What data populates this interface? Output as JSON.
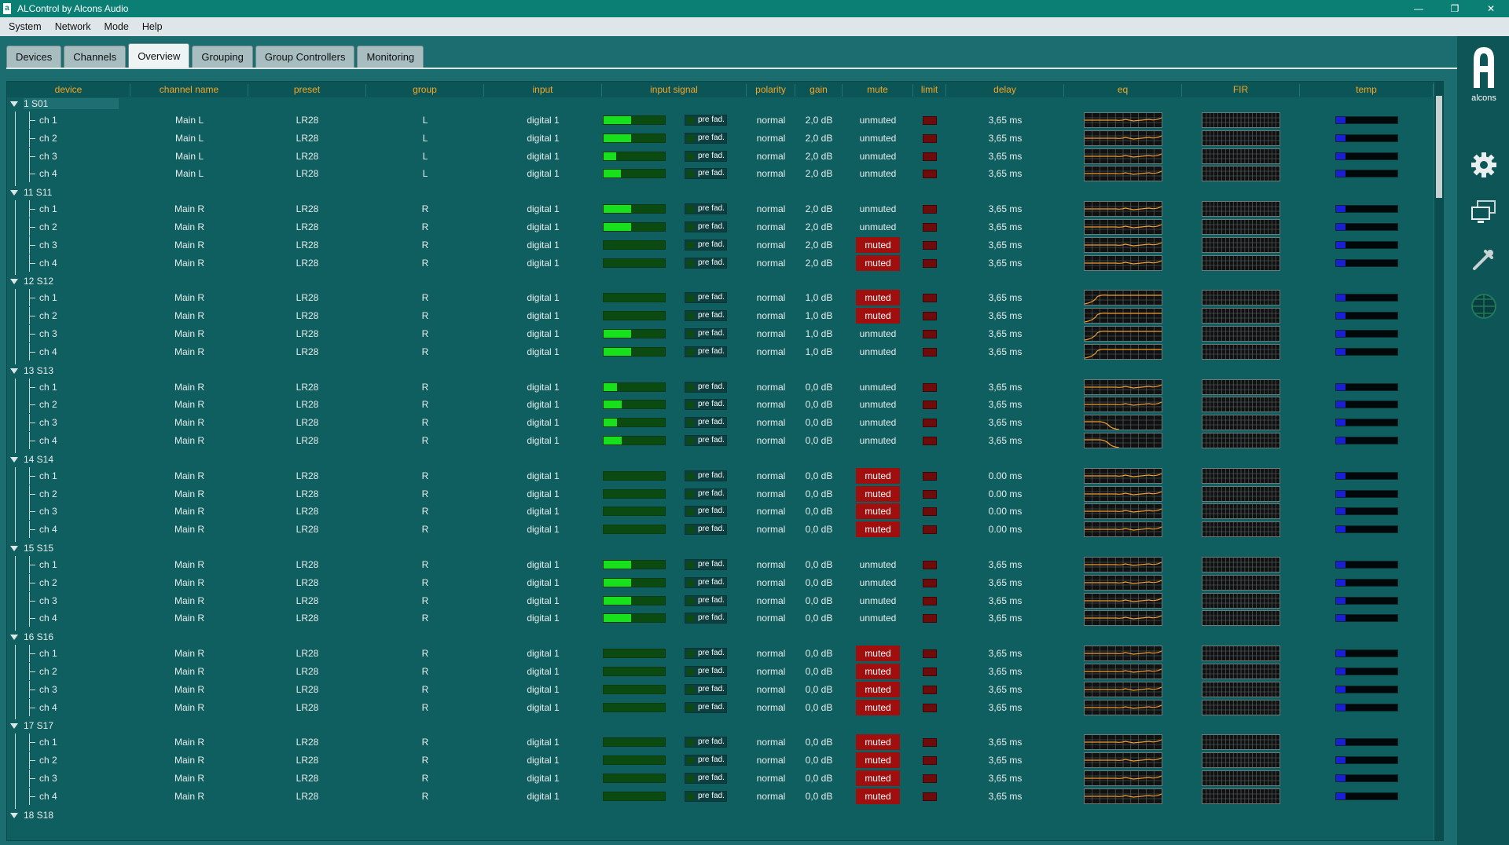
{
  "window": {
    "title": "ALControl by Alcons Audio",
    "min": "—",
    "restore": "❐",
    "close": "✕"
  },
  "menu": [
    "System",
    "Network",
    "Mode",
    "Help"
  ],
  "tabs": [
    {
      "label": "Devices",
      "active": false
    },
    {
      "label": "Channels",
      "active": false
    },
    {
      "label": "Overview",
      "active": true
    },
    {
      "label": "Grouping",
      "active": false
    },
    {
      "label": "Group Controllers",
      "active": false
    },
    {
      "label": "Monitoring",
      "active": false
    }
  ],
  "sidebar": {
    "logo": "alcons",
    "icons": [
      "settings-gear-icon",
      "network-computers-icon",
      "tools-icon",
      "globe-map-icon"
    ]
  },
  "columns": [
    "device",
    "channel name",
    "preset",
    "group",
    "input",
    "input signal",
    "polarity",
    "gain",
    "mute",
    "limit",
    "delay",
    "eq",
    "FIR",
    "temp"
  ],
  "pref_label": "pre fad.",
  "devices": [
    {
      "label": "1 S01",
      "selected": true,
      "channels": [
        {
          "ch": "ch 1",
          "name": "Main L",
          "preset": "LR28",
          "group": "L",
          "input": "digital 1",
          "signal": 0.45,
          "polarity": "normal",
          "gain": "2,0 dB",
          "mute": "unmuted",
          "delay": "3,65 ms",
          "eq": "flat",
          "temp": 0.15
        },
        {
          "ch": "ch 2",
          "name": "Main L",
          "preset": "LR28",
          "group": "L",
          "input": "digital 1",
          "signal": 0.45,
          "polarity": "normal",
          "gain": "2,0 dB",
          "mute": "unmuted",
          "delay": "3,65 ms",
          "eq": "flat",
          "temp": 0.15
        },
        {
          "ch": "ch 3",
          "name": "Main L",
          "preset": "LR28",
          "group": "L",
          "input": "digital 1",
          "signal": 0.2,
          "polarity": "normal",
          "gain": "2,0 dB",
          "mute": "unmuted",
          "delay": "3,65 ms",
          "eq": "flat",
          "temp": 0.15
        },
        {
          "ch": "ch 4",
          "name": "Main L",
          "preset": "LR28",
          "group": "L",
          "input": "digital 1",
          "signal": 0.28,
          "polarity": "normal",
          "gain": "2,0 dB",
          "mute": "unmuted",
          "delay": "3,65 ms",
          "eq": "flat",
          "temp": 0.15
        }
      ]
    },
    {
      "label": "11 S11",
      "selected": false,
      "channels": [
        {
          "ch": "ch 1",
          "name": "Main R",
          "preset": "LR28",
          "group": "R",
          "input": "digital 1",
          "signal": 0.45,
          "polarity": "normal",
          "gain": "2,0 dB",
          "mute": "unmuted",
          "delay": "3,65 ms",
          "eq": "flat",
          "temp": 0.15
        },
        {
          "ch": "ch 2",
          "name": "Main R",
          "preset": "LR28",
          "group": "R",
          "input": "digital 1",
          "signal": 0.45,
          "polarity": "normal",
          "gain": "2,0 dB",
          "mute": "unmuted",
          "delay": "3,65 ms",
          "eq": "flat",
          "temp": 0.15
        },
        {
          "ch": "ch 3",
          "name": "Main R",
          "preset": "LR28",
          "group": "R",
          "input": "digital 1",
          "signal": 0,
          "polarity": "normal",
          "gain": "2,0 dB",
          "mute": "muted",
          "delay": "3,65 ms",
          "eq": "flat",
          "temp": 0.15
        },
        {
          "ch": "ch 4",
          "name": "Main R",
          "preset": "LR28",
          "group": "R",
          "input": "digital 1",
          "signal": 0,
          "polarity": "normal",
          "gain": "2,0 dB",
          "mute": "muted",
          "delay": "3,65 ms",
          "eq": "flat",
          "temp": 0.15
        }
      ]
    },
    {
      "label": "12 S12",
      "selected": false,
      "channels": [
        {
          "ch": "ch 1",
          "name": "Main R",
          "preset": "LR28",
          "group": "R",
          "input": "digital 1",
          "signal": 0,
          "polarity": "normal",
          "gain": "1,0 dB",
          "mute": "muted",
          "delay": "3,65 ms",
          "eq": "highpass",
          "temp": 0.15
        },
        {
          "ch": "ch 2",
          "name": "Main R",
          "preset": "LR28",
          "group": "R",
          "input": "digital 1",
          "signal": 0,
          "polarity": "normal",
          "gain": "1,0 dB",
          "mute": "muted",
          "delay": "3,65 ms",
          "eq": "highpass",
          "temp": 0.15
        },
        {
          "ch": "ch 3",
          "name": "Main R",
          "preset": "LR28",
          "group": "R",
          "input": "digital 1",
          "signal": 0.45,
          "polarity": "normal",
          "gain": "1,0 dB",
          "mute": "unmuted",
          "delay": "3,65 ms",
          "eq": "highpass",
          "temp": 0.15
        },
        {
          "ch": "ch 4",
          "name": "Main R",
          "preset": "LR28",
          "group": "R",
          "input": "digital 1",
          "signal": 0.45,
          "polarity": "normal",
          "gain": "1,0 dB",
          "mute": "unmuted",
          "delay": "3,65 ms",
          "eq": "highpass",
          "temp": 0.15
        }
      ]
    },
    {
      "label": "13 S13",
      "selected": false,
      "channels": [
        {
          "ch": "ch 1",
          "name": "Main R",
          "preset": "LR28",
          "group": "R",
          "input": "digital 1",
          "signal": 0.22,
          "polarity": "normal",
          "gain": "0,0 dB",
          "mute": "unmuted",
          "delay": "3,65 ms",
          "eq": "flat",
          "temp": 0.15
        },
        {
          "ch": "ch 2",
          "name": "Main R",
          "preset": "LR28",
          "group": "R",
          "input": "digital 1",
          "signal": 0.3,
          "polarity": "normal",
          "gain": "0,0 dB",
          "mute": "unmuted",
          "delay": "3,65 ms",
          "eq": "flat",
          "temp": 0.15
        },
        {
          "ch": "ch 3",
          "name": "Main R",
          "preset": "LR28",
          "group": "R",
          "input": "digital 1",
          "signal": 0.22,
          "polarity": "normal",
          "gain": "0,0 dB",
          "mute": "unmuted",
          "delay": "3,65 ms",
          "eq": "lowpass",
          "temp": 0.15
        },
        {
          "ch": "ch 4",
          "name": "Main R",
          "preset": "LR28",
          "group": "R",
          "input": "digital 1",
          "signal": 0.3,
          "polarity": "normal",
          "gain": "0,0 dB",
          "mute": "unmuted",
          "delay": "3,65 ms",
          "eq": "lowpass",
          "temp": 0.15
        }
      ]
    },
    {
      "label": "14 S14",
      "selected": false,
      "channels": [
        {
          "ch": "ch 1",
          "name": "Main R",
          "preset": "LR28",
          "group": "R",
          "input": "digital 1",
          "signal": 0,
          "polarity": "normal",
          "gain": "0,0 dB",
          "mute": "muted",
          "delay": "0.00 ms",
          "eq": "flat",
          "temp": 0.15
        },
        {
          "ch": "ch 2",
          "name": "Main R",
          "preset": "LR28",
          "group": "R",
          "input": "digital 1",
          "signal": 0,
          "polarity": "normal",
          "gain": "0,0 dB",
          "mute": "muted",
          "delay": "0.00 ms",
          "eq": "flat",
          "temp": 0.15
        },
        {
          "ch": "ch 3",
          "name": "Main R",
          "preset": "LR28",
          "group": "R",
          "input": "digital 1",
          "signal": 0,
          "polarity": "normal",
          "gain": "0,0 dB",
          "mute": "muted",
          "delay": "0.00 ms",
          "eq": "flat",
          "temp": 0.15
        },
        {
          "ch": "ch 4",
          "name": "Main R",
          "preset": "LR28",
          "group": "R",
          "input": "digital 1",
          "signal": 0,
          "polarity": "normal",
          "gain": "0,0 dB",
          "mute": "muted",
          "delay": "0.00 ms",
          "eq": "flat",
          "temp": 0.15
        }
      ]
    },
    {
      "label": "15 S15",
      "selected": false,
      "channels": [
        {
          "ch": "ch 1",
          "name": "Main R",
          "preset": "LR28",
          "group": "R",
          "input": "digital 1",
          "signal": 0.45,
          "polarity": "normal",
          "gain": "0,0 dB",
          "mute": "unmuted",
          "delay": "3,65 ms",
          "eq": "flat",
          "temp": 0.15
        },
        {
          "ch": "ch 2",
          "name": "Main R",
          "preset": "LR28",
          "group": "R",
          "input": "digital 1",
          "signal": 0.45,
          "polarity": "normal",
          "gain": "0,0 dB",
          "mute": "unmuted",
          "delay": "3,65 ms",
          "eq": "flat",
          "temp": 0.15
        },
        {
          "ch": "ch 3",
          "name": "Main R",
          "preset": "LR28",
          "group": "R",
          "input": "digital 1",
          "signal": 0.45,
          "polarity": "normal",
          "gain": "0,0 dB",
          "mute": "unmuted",
          "delay": "3,65 ms",
          "eq": "flat",
          "temp": 0.15
        },
        {
          "ch": "ch 4",
          "name": "Main R",
          "preset": "LR28",
          "group": "R",
          "input": "digital 1",
          "signal": 0.45,
          "polarity": "normal",
          "gain": "0,0 dB",
          "mute": "unmuted",
          "delay": "3,65 ms",
          "eq": "flat",
          "temp": 0.15
        }
      ]
    },
    {
      "label": "16 S16",
      "selected": false,
      "channels": [
        {
          "ch": "ch 1",
          "name": "Main R",
          "preset": "LR28",
          "group": "R",
          "input": "digital 1",
          "signal": 0,
          "polarity": "normal",
          "gain": "0,0 dB",
          "mute": "muted",
          "delay": "3,65 ms",
          "eq": "flat",
          "temp": 0.15
        },
        {
          "ch": "ch 2",
          "name": "Main R",
          "preset": "LR28",
          "group": "R",
          "input": "digital 1",
          "signal": 0,
          "polarity": "normal",
          "gain": "0,0 dB",
          "mute": "muted",
          "delay": "3,65 ms",
          "eq": "flat",
          "temp": 0.15
        },
        {
          "ch": "ch 3",
          "name": "Main R",
          "preset": "LR28",
          "group": "R",
          "input": "digital 1",
          "signal": 0,
          "polarity": "normal",
          "gain": "0,0 dB",
          "mute": "muted",
          "delay": "3,65 ms",
          "eq": "flat",
          "temp": 0.15
        },
        {
          "ch": "ch 4",
          "name": "Main R",
          "preset": "LR28",
          "group": "R",
          "input": "digital 1",
          "signal": 0,
          "polarity": "normal",
          "gain": "0,0 dB",
          "mute": "muted",
          "delay": "3,65 ms",
          "eq": "flat",
          "temp": 0.15
        }
      ]
    },
    {
      "label": "17 S17",
      "selected": false,
      "channels": [
        {
          "ch": "ch 1",
          "name": "Main R",
          "preset": "LR28",
          "group": "R",
          "input": "digital 1",
          "signal": 0,
          "polarity": "normal",
          "gain": "0,0 dB",
          "mute": "muted",
          "delay": "3,65 ms",
          "eq": "flat",
          "temp": 0.15
        },
        {
          "ch": "ch 2",
          "name": "Main R",
          "preset": "LR28",
          "group": "R",
          "input": "digital 1",
          "signal": 0,
          "polarity": "normal",
          "gain": "0,0 dB",
          "mute": "muted",
          "delay": "3,65 ms",
          "eq": "flat",
          "temp": 0.15
        },
        {
          "ch": "ch 3",
          "name": "Main R",
          "preset": "LR28",
          "group": "R",
          "input": "digital 1",
          "signal": 0,
          "polarity": "normal",
          "gain": "0,0 dB",
          "mute": "muted",
          "delay": "3,65 ms",
          "eq": "flat",
          "temp": 0.15
        },
        {
          "ch": "ch 4",
          "name": "Main R",
          "preset": "LR28",
          "group": "R",
          "input": "digital 1",
          "signal": 0,
          "polarity": "normal",
          "gain": "0,0 dB",
          "mute": "muted",
          "delay": "3,65 ms",
          "eq": "flat",
          "temp": 0.15
        }
      ]
    },
    {
      "label": "18 S18",
      "selected": false,
      "channels": []
    }
  ],
  "colors": {
    "header_text": "#f5a623",
    "meter_on": "#18e01c",
    "mute_red": "#a10e0e",
    "eq_curve": "#f0a030",
    "temp_blue": "#1a1fd6"
  }
}
